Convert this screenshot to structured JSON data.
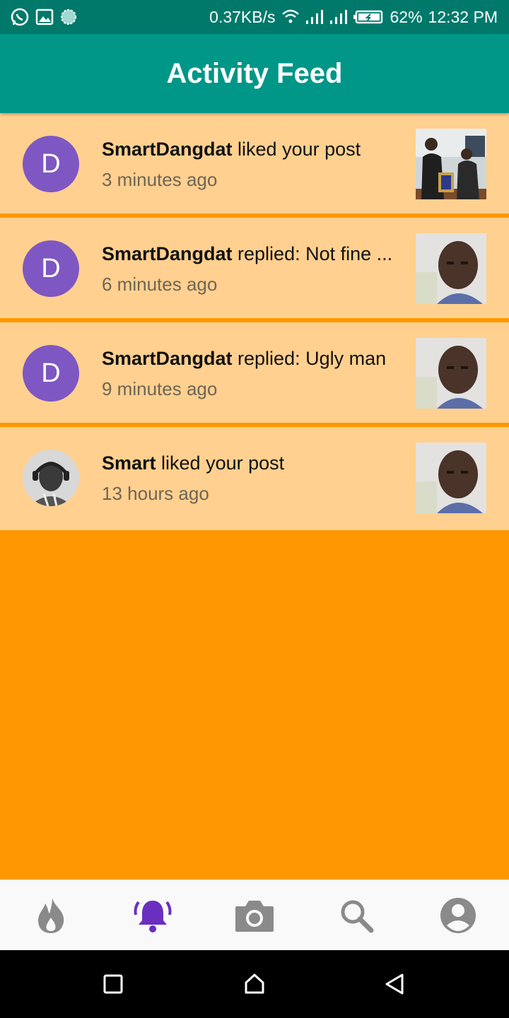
{
  "status_bar": {
    "speed": "0.37KB/s",
    "battery": "62%",
    "time": "12:32 PM",
    "icons": [
      "whatsapp-icon",
      "gallery-icon",
      "sync-icon",
      "wifi-icon",
      "signal-icon",
      "signal-icon",
      "battery-icon"
    ]
  },
  "app_bar": {
    "title": "Activity Feed"
  },
  "feed": {
    "items": [
      {
        "avatar_letter": "D",
        "avatar_type": "letter",
        "user": "SmartDangdat",
        "action": " liked your post",
        "time": "3 minutes ago",
        "thumb": "group-photo"
      },
      {
        "avatar_letter": "D",
        "avatar_type": "letter",
        "user": "SmartDangdat",
        "action": " replied: Not fine ...",
        "time": "6 minutes ago",
        "thumb": "selfie"
      },
      {
        "avatar_letter": "D",
        "avatar_type": "letter",
        "user": "SmartDangdat",
        "action": " replied: Ugly man",
        "time": "9 minutes ago",
        "thumb": "selfie"
      },
      {
        "avatar_letter": "",
        "avatar_type": "photo",
        "user": "Smart",
        "action": " liked your post",
        "time": "13 hours ago",
        "thumb": "selfie"
      }
    ]
  },
  "bottom_nav": {
    "items": [
      {
        "icon": "flame-icon",
        "active": false
      },
      {
        "icon": "bell-icon",
        "active": true
      },
      {
        "icon": "camera-icon",
        "active": false
      },
      {
        "icon": "search-icon",
        "active": false
      },
      {
        "icon": "account-icon",
        "active": false
      }
    ]
  },
  "colors": {
    "app_bar": "#009688",
    "status_bar": "#00796b",
    "feed_item": "#ffd08f",
    "page_background": "#ff9800",
    "avatar": "#7e57c2",
    "active_nav": "#6a2fc0",
    "inactive_nav": "#8a8a8a"
  }
}
